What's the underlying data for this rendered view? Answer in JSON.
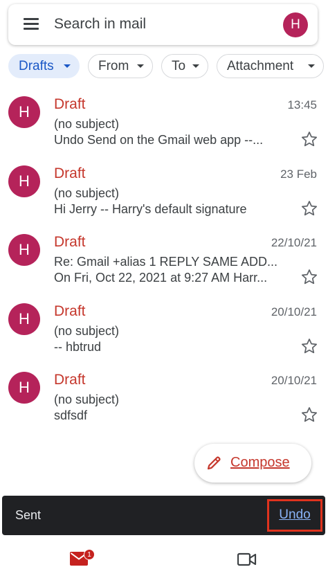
{
  "search": {
    "placeholder": "Search in mail",
    "avatar_initial": "H"
  },
  "filters": [
    {
      "label": "Drafts",
      "active": true
    },
    {
      "label": "From",
      "active": false
    },
    {
      "label": "To",
      "active": false
    },
    {
      "label": "Attachment",
      "active": false
    }
  ],
  "mails": [
    {
      "initial": "H",
      "sender": "Draft",
      "date": "13:45",
      "subject": "(no subject)",
      "snippet": "Undo Send on the Gmail web app --..."
    },
    {
      "initial": "H",
      "sender": "Draft",
      "date": "23 Feb",
      "subject": "(no subject)",
      "snippet": "Hi Jerry -- Harry's default signature"
    },
    {
      "initial": "H",
      "sender": "Draft",
      "date": "22/10/21",
      "subject": "Re: Gmail +alias 1 REPLY SAME ADD...",
      "snippet": "On Fri, Oct 22, 2021 at 9:27 AM Harr..."
    },
    {
      "initial": "H",
      "sender": "Draft",
      "date": "20/10/21",
      "subject": "(no subject)",
      "snippet": "-- hbtrud"
    },
    {
      "initial": "H",
      "sender": "Draft",
      "date": "20/10/21",
      "subject": "(no subject)",
      "snippet": "sdfsdf"
    }
  ],
  "compose": {
    "label": "Compose"
  },
  "snackbar": {
    "text": "Sent",
    "action": "Undo"
  },
  "bottom_nav": {
    "mail_badge": "1"
  },
  "colors": {
    "avatar": "#b5235a",
    "draft_label": "#c5372c",
    "active_chip_bg": "#e3ecfb",
    "active_chip_text": "#1a57c6",
    "snackbar_bg": "#202124",
    "undo_link": "#8ab4f8",
    "highlight_border": "#e0331e"
  }
}
